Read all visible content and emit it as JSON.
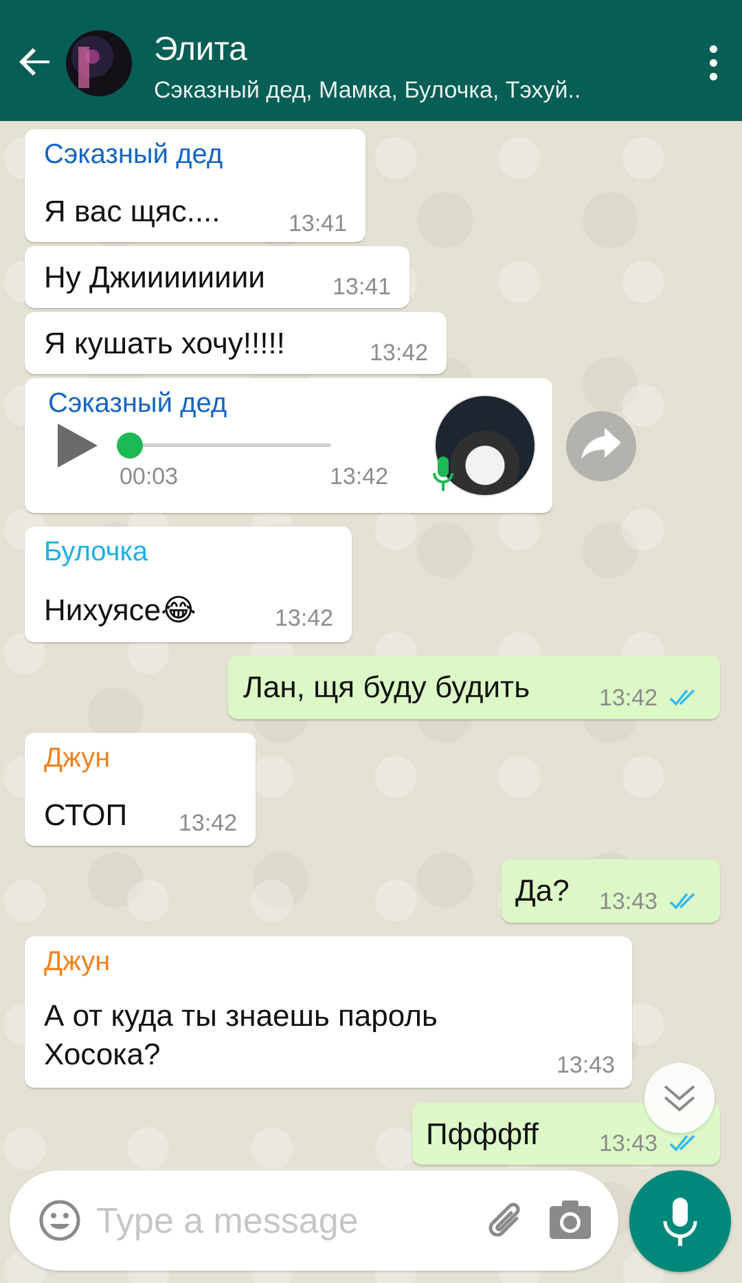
{
  "header": {
    "title": "Элита",
    "subtitle": "Сэказный дед, Мамка, Булочка, Тэхуй.."
  },
  "messages": [
    {
      "sender": "Сэказный дед",
      "text": "Я вас щяс....",
      "time": "13:41"
    },
    {
      "text": "Ну Джииииииии",
      "time": "13:41"
    },
    {
      "text": "Я кушать хочу!!!!!",
      "time": "13:42"
    },
    {
      "sender": "Сэказный дед",
      "type": "voice",
      "duration": "00:03",
      "time": "13:42"
    },
    {
      "sender": "Булочка",
      "text": "Нихуясе😂",
      "time": "13:42"
    },
    {
      "outgoing": true,
      "text": "Лан, щя буду будить",
      "time": "13:42"
    },
    {
      "sender": "Джун",
      "text": "СТОП",
      "time": "13:42"
    },
    {
      "outgoing": true,
      "text": "Да?",
      "time": "13:43"
    },
    {
      "sender": "Джун",
      "text_line1": "А от куда ты знаешь пароль",
      "text_line2": "Хосока?",
      "time": "13:43"
    },
    {
      "outgoing": true,
      "text": "Пфффff",
      "time": "13:43"
    }
  ],
  "input": {
    "placeholder": "Type a message"
  },
  "colors": {
    "header": "#075e54",
    "sender_blue": "#1565c0",
    "sender_cyan": "#1faee5",
    "sender_orange": "#f0821e",
    "outgoing_bubble": "#dcf8c6",
    "read_ticks": "#34b7f1",
    "mic_button": "#00897b"
  },
  "icons": [
    "back-arrow-icon",
    "more-vert-icon",
    "play-icon",
    "mic-icon",
    "forward-icon",
    "chevron-down-icon",
    "emoji-icon",
    "attach-icon",
    "camera-icon"
  ]
}
